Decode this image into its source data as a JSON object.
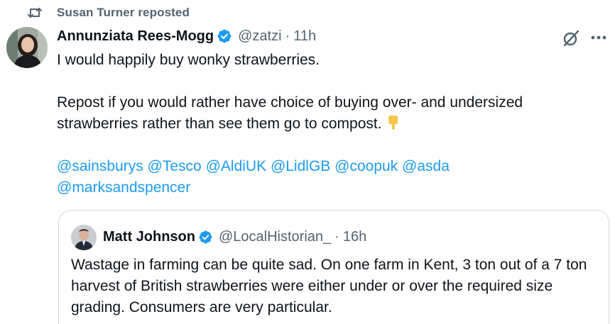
{
  "repost": {
    "label": "Susan Turner reposted"
  },
  "post": {
    "author_name": "Annunziata Rees-Mogg",
    "handle": "@zatzi",
    "separator": "·",
    "time": "11h",
    "line1": "I would happily buy wonky strawberries.",
    "line2": "Repost if you would rather have choice of buying over- and undersized strawberries rather than see them go to compost.",
    "emoji": "backhand-index-pointing-down",
    "mentions": [
      "@sainsburys",
      "@Tesco",
      "@AldiUK",
      "@LidlGB",
      "@coopuk",
      "@asda",
      "@marksandspencer"
    ]
  },
  "quote": {
    "author_name": "Matt Johnson",
    "handle": "@LocalHistorian_",
    "separator": "·",
    "time": "16h",
    "text": "Wastage in farming can be quite sad. On one farm in Kent, 3 ton out of a 7 ton harvest of British strawberries were either under or over the required size grading. Consumers are very particular."
  },
  "colors": {
    "accent": "#1d9bf0",
    "secondary_text": "#536471",
    "border": "#cfd9de",
    "verified": "#1d9bf0"
  },
  "icons": [
    "repost-icon",
    "verified-badge-icon",
    "grok-icon",
    "more-icon",
    "backhand-index-pointing-down-icon"
  ]
}
